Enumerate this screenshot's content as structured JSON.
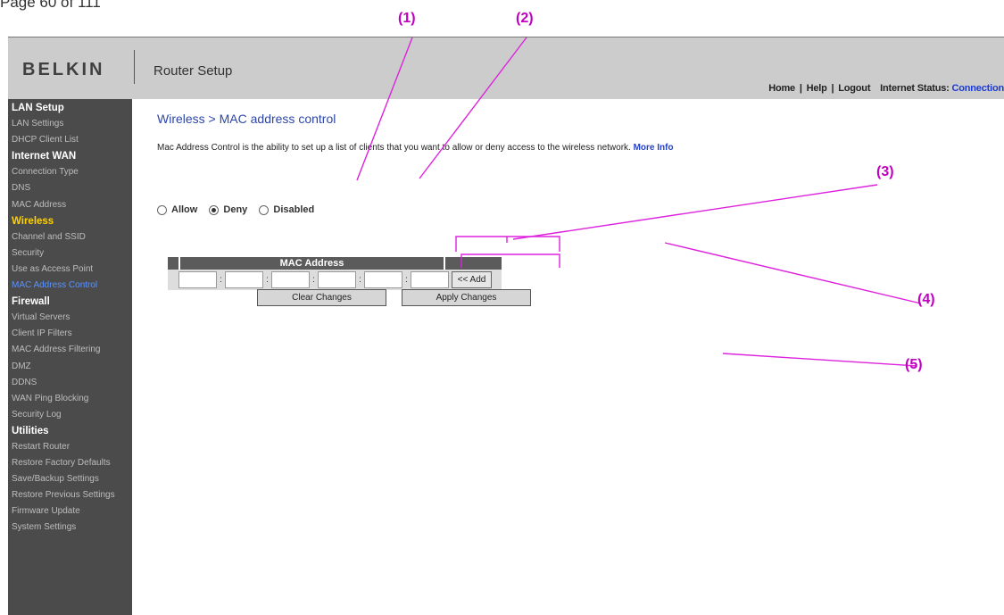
{
  "page_label": "Page 60 of 111",
  "header": {
    "brand": "BELKIN",
    "title": "Router Setup",
    "links": [
      "Home",
      "Help",
      "Logout"
    ],
    "separator": "|",
    "status_label": "Internet Status:",
    "status_value": "Connection"
  },
  "sidebar": {
    "sections": [
      {
        "title": "LAN Setup",
        "items": [
          "LAN Settings",
          "DHCP Client List"
        ]
      },
      {
        "title": "Internet WAN",
        "items": [
          "Connection Type",
          "DNS",
          "MAC Address"
        ]
      },
      {
        "title": "Wireless",
        "items": [
          "Channel and SSID",
          "Security",
          "Use as Access Point",
          "MAC Address Control"
        ]
      },
      {
        "title": "Firewall",
        "items": [
          "Virtual Servers",
          "Client IP Filters",
          "MAC Address Filtering",
          "DMZ",
          "DDNS",
          "WAN Ping Blocking",
          "Security Log"
        ]
      },
      {
        "title": "Utilities",
        "items": [
          "Restart Router",
          "Restore Factory Defaults",
          "Save/Backup Settings",
          "Restore Previous Settings",
          "Firmware Update",
          "System Settings"
        ]
      }
    ],
    "active_section": "Wireless",
    "active_item": "MAC Address Control"
  },
  "main": {
    "title": "Wireless > MAC address control",
    "description": "Mac Address Control is the ability to set up a list of clients that you want to allow or deny access to the wireless network.",
    "more_info": "More Info",
    "radio_options": [
      {
        "label": "Allow",
        "selected": false
      },
      {
        "label": "Deny",
        "selected": true
      },
      {
        "label": "Disabled",
        "selected": false
      }
    ],
    "mac_table_header": "MAC Address",
    "mac_separator": ":",
    "add_button": "<< Add",
    "clear_button": "Clear Changes",
    "apply_button": "Apply Changes"
  },
  "callouts": [
    "(1)",
    "(2)",
    "(3)",
    "(4)",
    "(5)"
  ],
  "colors": {
    "callout": "#c000c0",
    "sidebar_bg": "#4b4b4b",
    "header_bg": "#cccccc",
    "title_blue": "#2d46a8",
    "active_item": "#5a92ff",
    "active_section": "#ffd200"
  }
}
